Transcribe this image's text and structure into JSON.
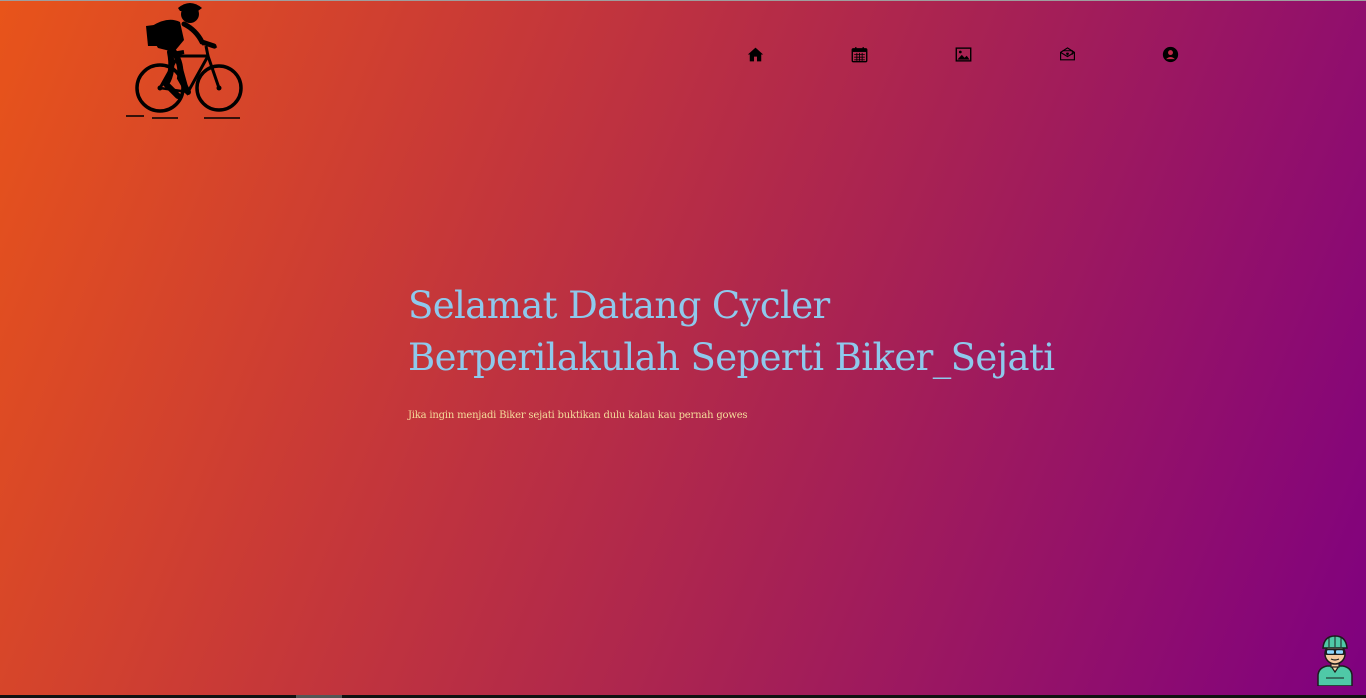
{
  "logo": {
    "icon": "cyclist-logo-icon"
  },
  "nav": {
    "items": [
      {
        "icon": "home-icon",
        "label": "Home"
      },
      {
        "icon": "calendar-icon",
        "label": "Calendar"
      },
      {
        "icon": "image-icon",
        "label": "Gallery"
      },
      {
        "icon": "mail-icon",
        "label": "Contact"
      },
      {
        "icon": "user-icon",
        "label": "Profile"
      }
    ]
  },
  "hero": {
    "title_line1": "Selamat Datang Cycler",
    "title_line2": "Berperilakulah Seperti Biker_Sejati",
    "subtitle": "Jika ingin menjadi Biker sejati buktikan dulu kalau kau pernah gowes"
  },
  "chat": {
    "icon": "cyclist-avatar-icon"
  },
  "colors": {
    "gradient_start": "#e8541a",
    "gradient_end": "#7f0080",
    "title": "#8ec9ec",
    "subtitle": "#f5dc9a"
  }
}
